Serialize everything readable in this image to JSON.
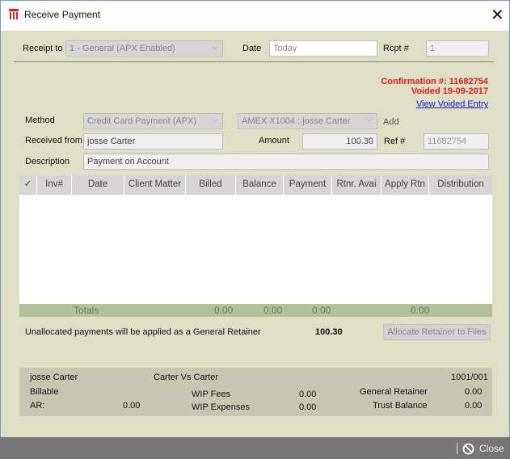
{
  "window": {
    "title": "Receive Payment",
    "close_glyph": "✕"
  },
  "header": {
    "receipt_to_label": "Receipt to",
    "receipt_to_value": "1 - General (APX Enabled)",
    "date_label": "Date",
    "date_value": "Today",
    "rcpt_label": "Rcpt #",
    "rcpt_value": "1"
  },
  "status": {
    "confirmation": "Confirmation #: 11682754",
    "voided": "Voided 19-09-2017",
    "view_voided": "View Voided Entry"
  },
  "form": {
    "method_label": "Method",
    "method_value": "Credit Card Payment (APX)",
    "card_value": "AMEX X1004 : josse Carter",
    "add_label": "Add",
    "received_from_label": "Received from",
    "received_from_value": "josse Carter",
    "amount_label": "Amount",
    "amount_value": "100.30",
    "ref_label": "Ref #",
    "ref_value": "11682754",
    "description_label": "Description",
    "description_value": "Payment on Account"
  },
  "table": {
    "columns": [
      "✓",
      "Inv#",
      "Date",
      "Client Matter",
      "Billed",
      "Balance",
      "Payment",
      "Rtnr. Avai",
      "Apply Rtn",
      "Distribution"
    ],
    "rows": [],
    "totals": {
      "label": "Totals",
      "billed": "0.00",
      "balance": "0.00",
      "payment": "0.00",
      "apply_rtn": "0.00"
    }
  },
  "unallocated": {
    "text": "Unallocated payments will be applied as a General Retainer",
    "amount": "100.30",
    "button": "Allocate Retainer to Files"
  },
  "summary": {
    "client": "josse Carter",
    "matter": "Carter Vs Carter",
    "matter_no": "1001/001",
    "billable": "Billable",
    "ar_label": "AR:",
    "ar_value": "0.00",
    "wip_fees_label": "WIP Fees",
    "wip_fees_value": "0.00",
    "wip_exp_label": "WIP Expenses",
    "wip_exp_value": "0.00",
    "gen_ret_label": "General Retainer",
    "gen_ret_value": "0.00",
    "trust_label": "Trust Balance",
    "trust_value": "0.00"
  },
  "footer": {
    "close_label": "Close"
  },
  "colors": {
    "background": "#dfdfc6",
    "status_red": "#e31b1b",
    "link": "#1a1ad0",
    "totals_bar": "#b1c198"
  }
}
